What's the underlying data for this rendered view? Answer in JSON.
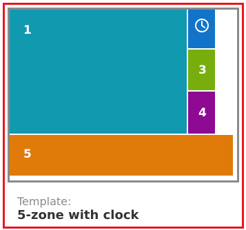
{
  "template": {
    "label": "Template:",
    "name": "5-zone with clock"
  },
  "zones": {
    "zone1": {
      "label": "1",
      "color": "#1199b0"
    },
    "clock": {
      "icon": "clock-icon",
      "color": "#1274c8"
    },
    "zone3": {
      "label": "3",
      "color": "#78ae0c"
    },
    "zone4": {
      "label": "4",
      "color": "#8e0a93"
    },
    "zone5": {
      "label": "5",
      "color": "#e07a09"
    }
  },
  "colors": {
    "selection_border": "#e8171c",
    "preview_border": "#8a8a8a"
  }
}
